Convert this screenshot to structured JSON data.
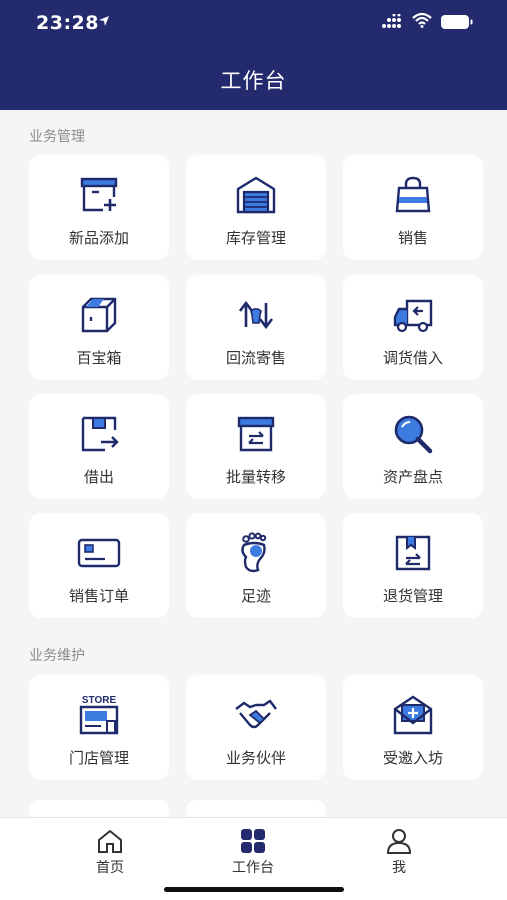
{
  "status_bar": {
    "time": "23:28"
  },
  "header": {
    "title": "工作台"
  },
  "sections": [
    {
      "title": "业务管理"
    },
    {
      "title": "业务维护"
    }
  ],
  "tiles": [
    {
      "label": "新品添加",
      "icon": "new-product-add-icon"
    },
    {
      "label": "库存管理",
      "icon": "warehouse-icon"
    },
    {
      "label": "销售",
      "icon": "shopping-bag-icon"
    },
    {
      "label": "百宝箱",
      "icon": "treasure-box-icon"
    },
    {
      "label": "回流寄售",
      "icon": "return-consign-icon"
    },
    {
      "label": "调货借入",
      "icon": "delivery-truck-icon"
    },
    {
      "label": "借出",
      "icon": "lend-out-icon"
    },
    {
      "label": "批量转移",
      "icon": "batch-transfer-icon"
    },
    {
      "label": "资产盘点",
      "icon": "magnifier-icon"
    },
    {
      "label": "销售订单",
      "icon": "card-icon"
    },
    {
      "label": "足迹",
      "icon": "footprint-icon"
    },
    {
      "label": "退货管理",
      "icon": "return-manage-icon"
    },
    {
      "label": "门店管理",
      "icon": "store-icon"
    },
    {
      "label": "业务伙伴",
      "icon": "handshake-icon"
    },
    {
      "label": "受邀入坊",
      "icon": "invitation-icon"
    }
  ],
  "store_icon_text": "STORE",
  "tabbar": {
    "items": [
      {
        "label": "首页",
        "icon": "home-icon",
        "active": false
      },
      {
        "label": "工作台",
        "icon": "grid-icon",
        "active": true
      },
      {
        "label": "我",
        "icon": "person-icon",
        "active": false
      }
    ]
  },
  "colors": {
    "header_bg": "#232a6e",
    "icon_primary": "#1f2a6b",
    "icon_accent": "#3d7be0"
  }
}
